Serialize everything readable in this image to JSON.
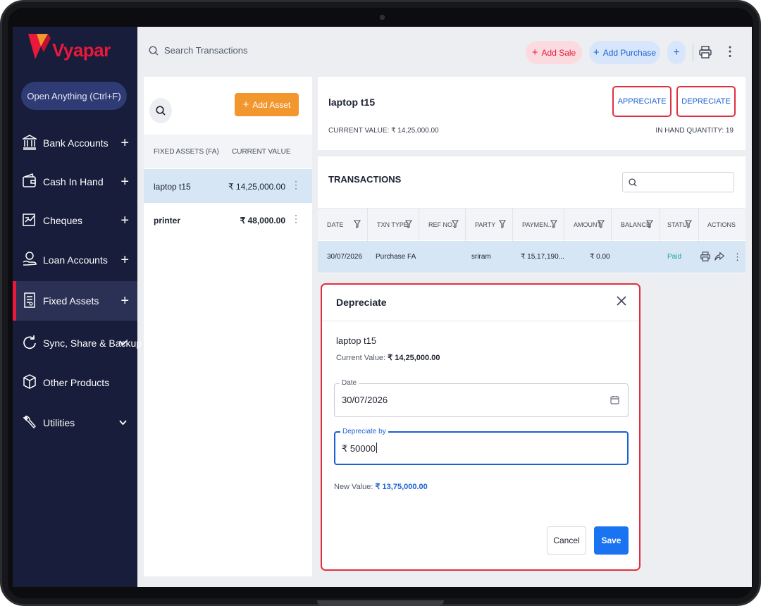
{
  "app": {
    "name": "Vyapar"
  },
  "colors": {
    "brand": "#e8193c",
    "accent": "#1a60d4",
    "sidebar_bg": "#171d3a",
    "add_asset": "#f2962e",
    "paid": "#1aa7a2"
  },
  "sidebar": {
    "open_anything": "Open Anything (Ctrl+F)",
    "items": [
      {
        "label": "Bank Accounts",
        "icon": "bank-icon",
        "trail": "+"
      },
      {
        "label": "Cash In Hand",
        "icon": "wallet-icon",
        "trail": "+"
      },
      {
        "label": "Cheques",
        "icon": "cheque-icon",
        "trail": "+"
      },
      {
        "label": "Loan Accounts",
        "icon": "loan-icon",
        "trail": "+"
      },
      {
        "label": "Fixed Assets",
        "icon": "fixed-assets-icon",
        "trail": "+",
        "active": true
      },
      {
        "label": "Sync, Share & Backup",
        "icon": "sync-icon",
        "trail": "chevron-down"
      },
      {
        "label": "Other Products",
        "icon": "box-icon",
        "trail": ""
      },
      {
        "label": "Utilities",
        "icon": "wrench-icon",
        "trail": "chevron-down"
      }
    ]
  },
  "topbar": {
    "search_placeholder": "Search Transactions",
    "add_sale": "Add Sale",
    "add_purchase": "Add Purchase",
    "plus": "+"
  },
  "assets": {
    "add_asset": "Add Asset",
    "col_name": "FIXED ASSETS (FA)",
    "col_value": "CURRENT VALUE",
    "rows": [
      {
        "name": "laptop t15",
        "value": "₹ 14,25,000.00",
        "selected": true
      },
      {
        "name": "printer",
        "value": "₹ 48,000.00",
        "selected": false
      }
    ]
  },
  "detail": {
    "title": "laptop t15",
    "appreciate": "APPRECIATE",
    "depreciate": "DEPRECIATE",
    "current_value": "CURRENT VALUE: ₹ 14,25,000.00",
    "in_hand": "IN HAND QUANTITY: 19"
  },
  "transactions": {
    "title": "TRANSACTIONS",
    "columns": [
      "DATE",
      "TXN TYPE",
      "REF NO.",
      "PARTY",
      "PAYMEN...",
      "AMOUNT",
      "BALANCE",
      "STATU",
      "ACTIONS"
    ],
    "rows": [
      {
        "date": "30/07/2026",
        "type": "Purchase FA",
        "ref": "",
        "party": "sriram",
        "payment": "₹ 15,17,190...",
        "amount": "₹ 0.00",
        "balance": "",
        "status": "Paid"
      }
    ]
  },
  "dialog": {
    "title": "Depreciate",
    "asset_name": "laptop t15",
    "current_value_label": "Current Value:",
    "current_value": "₹ 14,25,000.00",
    "date_label": "Date",
    "date_value": "30/07/2026",
    "dep_label": "Depreciate by",
    "dep_value": "₹ 50000",
    "new_value_label": "New Value:",
    "new_value": "₹ 13,75,000.00",
    "cancel": "Cancel",
    "save": "Save"
  }
}
